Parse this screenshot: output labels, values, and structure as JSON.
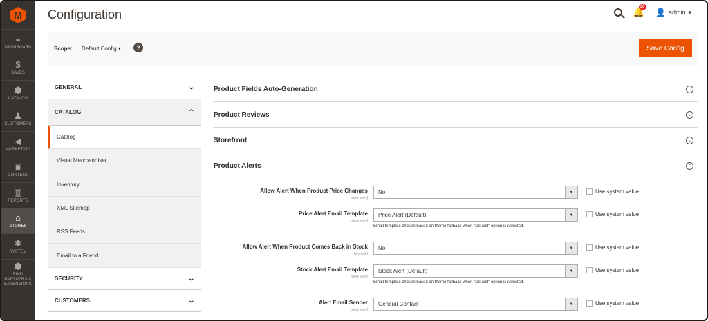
{
  "menu": {
    "items": [
      {
        "label": "DASHBOARD",
        "icon": "dashboard-icon",
        "glyph": "◒"
      },
      {
        "label": "SALES",
        "icon": "dollar-icon",
        "glyph": "$"
      },
      {
        "label": "CATALOG",
        "icon": "cube-icon",
        "glyph": "⬢"
      },
      {
        "label": "CUSTOMERS",
        "icon": "person-icon",
        "glyph": "♟"
      },
      {
        "label": "MARKETING",
        "icon": "megaphone-icon",
        "glyph": "◀"
      },
      {
        "label": "CONTENT",
        "icon": "content-icon",
        "glyph": "▣"
      },
      {
        "label": "REPORTS",
        "icon": "bar-chart-icon",
        "glyph": "▥"
      },
      {
        "label": "STORES",
        "icon": "store-icon",
        "glyph": "⌂"
      },
      {
        "label": "SYSTEM",
        "icon": "gear-icon",
        "glyph": "✱"
      },
      {
        "label": "FIND PARTNERS & EXTENSIONS",
        "icon": "extensions-icon",
        "glyph": "⬢"
      }
    ]
  },
  "header": {
    "title": "Configuration",
    "notifications_count": "30",
    "user": "admin"
  },
  "scope": {
    "label": "Scope:",
    "value": "Default Config ▾",
    "save_label": "Save Config"
  },
  "tabs": {
    "general": "GENERAL",
    "catalog": "CATALOG",
    "catalog_items": [
      "Catalog",
      "Visual Merchandiser",
      "Inventory",
      "XML Sitemap",
      "RSS Feeds",
      "Email to a Friend"
    ],
    "security": "SECURITY",
    "customers": "CUSTOMERS"
  },
  "sections": {
    "s1": "Product Fields Auto-Generation",
    "s2": "Product Reviews",
    "s3": "Storefront",
    "s4": "Product Alerts"
  },
  "fields": [
    {
      "label": "Allow Alert When Product Price Changes",
      "scope": "[store view]",
      "value": "No",
      "note": "",
      "system": "Use system value"
    },
    {
      "label": "Price Alert Email Template",
      "scope": "[store view]",
      "value": "Price Alert (Default)",
      "note": "Email template chosen based on theme fallback when \"Default\" option is selected.",
      "system": "Use system value"
    },
    {
      "label": "Allow Alert When Product Comes Back in Stock",
      "scope": "[website]",
      "value": "No",
      "note": "",
      "system": "Use system value"
    },
    {
      "label": "Stock Alert Email Template",
      "scope": "[store view]",
      "value": "Stock Alert (Default)",
      "note": "Email template chosen based on theme fallback when \"Default\" option is selected.",
      "system": "Use system value"
    },
    {
      "label": "Alert Email Sender",
      "scope": "[store view]",
      "value": "General Contact",
      "note": "",
      "system": "Use system value"
    }
  ],
  "colors": {
    "accent": "#eb5202",
    "menu_bg": "#373330"
  }
}
